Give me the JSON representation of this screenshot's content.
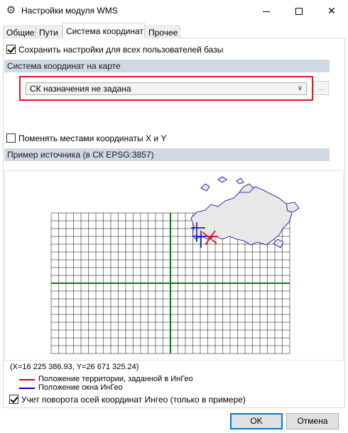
{
  "window": {
    "title": "Настройки модуля WMS"
  },
  "tabs": [
    {
      "label": "Общие"
    },
    {
      "label": "Пути"
    },
    {
      "label": "Система координат"
    },
    {
      "label": "Прочее"
    }
  ],
  "save_for_all": {
    "label": "Сохранить настройки для всех пользователей базы",
    "checked": true
  },
  "map_cs_section": {
    "title": "Система координат на карте"
  },
  "cs_combo": {
    "value": "СК назначения не задана",
    "button_label": "..."
  },
  "swap_xy": {
    "label": "Поменять местами координаты X и Y",
    "checked": false
  },
  "source_section": {
    "title": "Пример источника (в СК EPSG:3857)"
  },
  "coords_readout": "(X=16 225 386.93, Y=26 671 325.24)",
  "legend": [
    {
      "label": "Положение территории, заданной в ИнГео",
      "color": "#e00000"
    },
    {
      "label": "Положение окна ИнГео",
      "color": "#0000cc"
    }
  ],
  "rotation": {
    "label": "Учет поворота осей координат Ингео (только в примере)",
    "checked": true
  },
  "buttons": {
    "ok": "OK",
    "cancel": "Отмена"
  },
  "colors": {
    "section_bg": "#cfd8e3",
    "highlight_border": "#e81123",
    "axis": "#008000",
    "grid": "#000000"
  }
}
